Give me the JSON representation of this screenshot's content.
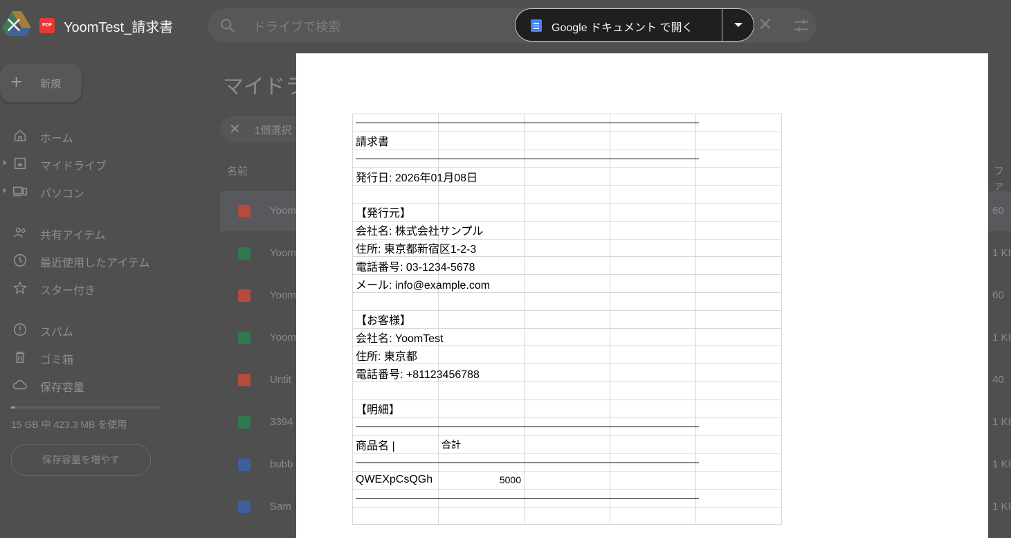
{
  "viewer": {
    "file_title": "YoomTest_請求書",
    "file_badge": "PDF",
    "open_button_label": "Google ドキュメント で開く",
    "search_placeholder": "ドライブで検索"
  },
  "drive": {
    "new_button": "新規",
    "nav": [
      {
        "label": "ホーム"
      },
      {
        "label": "マイドライブ"
      },
      {
        "label": "パソコン"
      },
      {
        "label": "共有アイテム"
      },
      {
        "label": "最近使用したアイテム"
      },
      {
        "label": "スター付き"
      },
      {
        "label": "スパム"
      },
      {
        "label": "ゴミ箱"
      },
      {
        "label": "保存容量"
      }
    ],
    "storage_text": "15 GB 中 423.3 MB を使用",
    "storage_fraction": 0.03,
    "storage_button": "保存容量を増やす",
    "main_title": "マイドラ",
    "selection_text": "1個選択",
    "col_name": "名前",
    "col_right": "ファ",
    "files": [
      {
        "name": "Yoom",
        "type": "pdf",
        "size": "60",
        "selected": true
      },
      {
        "name": "Yoom",
        "type": "sheet",
        "size": "1 KI"
      },
      {
        "name": "Yoom",
        "type": "pdf",
        "size": "60"
      },
      {
        "name": "Yoom",
        "type": "sheet",
        "size": "1 KI"
      },
      {
        "name": "Untit",
        "type": "pdf",
        "size": "40"
      },
      {
        "name": "3394",
        "type": "sheet",
        "size": "1 KI"
      },
      {
        "name": "bubb",
        "type": "doc",
        "size": "1 KI"
      },
      {
        "name": "Sam",
        "type": "doc",
        "size": "1 KI"
      }
    ]
  },
  "invoice": {
    "title": "請求書",
    "issue_date": "発行日: 2026年01月08日",
    "issuer_header": "【発行元】",
    "issuer_company": "会社名: 株式会社サンプル",
    "issuer_address": "住所: 東京都新宿区1-2-3",
    "issuer_phone": "電話番号: 03-1234-5678",
    "issuer_email": "メール: info@example.com",
    "customer_header": "【お客様】",
    "customer_company": "会社名: YoomTest",
    "customer_address": "住所: 東京都",
    "customer_phone": "電話番号: +81123456788",
    "details_header": "【明細】",
    "col_product": "商品名 |",
    "col_total": "合計",
    "item_name": "QWEXpCsQGh",
    "item_total": "5000"
  }
}
